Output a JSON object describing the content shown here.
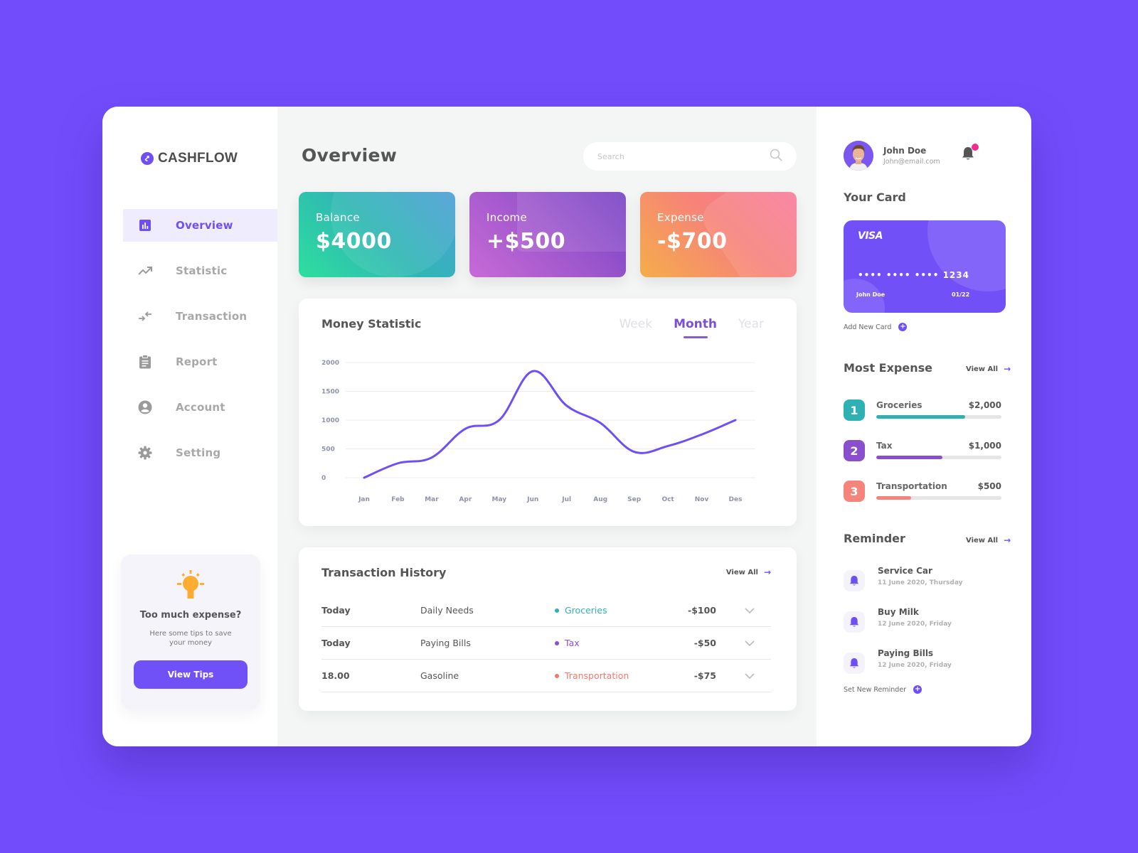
{
  "app": {
    "name": "CASHFLOW"
  },
  "sidebar": {
    "items": [
      {
        "label": "Overview",
        "icon": "bar-chart-icon",
        "active": true
      },
      {
        "label": "Statistic",
        "icon": "trending-up-icon",
        "active": false
      },
      {
        "label": "Transaction",
        "icon": "swap-arrows-icon",
        "active": false
      },
      {
        "label": "Report",
        "icon": "clipboard-icon",
        "active": false
      },
      {
        "label": "Account",
        "icon": "account-circle-icon",
        "active": false
      },
      {
        "label": "Setting",
        "icon": "gear-icon",
        "active": false
      }
    ],
    "tips": {
      "title": "Too much expense?",
      "subtitle": "Here some tips to save your money",
      "button": "View Tips"
    }
  },
  "main": {
    "title": "Overview",
    "search": {
      "placeholder": "Search",
      "value": ""
    },
    "cards": [
      {
        "label": "Balance",
        "value": "$4000"
      },
      {
        "label": "Income",
        "value": "+$500"
      },
      {
        "label": "Expense",
        "value": "-$700"
      }
    ],
    "money_statistic": {
      "title": "Money Statistic",
      "tabs": [
        {
          "label": "Week",
          "active": false
        },
        {
          "label": "Month",
          "active": true
        },
        {
          "label": "Year",
          "active": false
        }
      ]
    },
    "transactions": {
      "title": "Transaction History",
      "view_all": "View All",
      "rows": [
        {
          "date": "Today",
          "description": "Daily Needs",
          "category": "Groceries",
          "category_color": "#2fb1b3",
          "amount": "-$100"
        },
        {
          "date": "Today",
          "description": "Paying Bills",
          "category": "Tax",
          "category_color": "#8a4fcc",
          "amount": "-$50"
        },
        {
          "date": "18.00",
          "description": "Gasoline",
          "category": "Transportation",
          "category_color": "#f3786d",
          "amount": "-$75"
        }
      ]
    }
  },
  "chart_data": {
    "type": "line",
    "title": "Money Statistic",
    "categories": [
      "Jan",
      "Feb",
      "Mar",
      "Apr",
      "May",
      "Jun",
      "Jul",
      "Aug",
      "Sep",
      "Oct",
      "Nov",
      "Des"
    ],
    "series": [
      {
        "name": "Money",
        "values": [
          0,
          250,
          350,
          850,
          1000,
          1850,
          1250,
          950,
          450,
          550,
          750,
          1000
        ],
        "color": "#6f4ef5"
      }
    ],
    "yticks": [
      0,
      500,
      1000,
      1500,
      2000
    ],
    "ylim": [
      0,
      2000
    ],
    "xlabel": "",
    "ylabel": "",
    "grid": true,
    "legend": "none"
  },
  "right": {
    "user": {
      "name": "John Doe",
      "email": "John@email.com",
      "has_notification": true
    },
    "your_card": {
      "title": "Your Card",
      "brand": "VISA",
      "number": "•••• •••• •••• 1234",
      "holder": "John Doe",
      "expiry": "01/22",
      "add_label": "Add New Card"
    },
    "most_expense": {
      "title": "Most Expense",
      "view_all": "View All",
      "items": [
        {
          "rank": "1",
          "name": "Groceries",
          "amount": "$2,000",
          "progress": 0.71,
          "color": "#2fb1b3"
        },
        {
          "rank": "2",
          "name": "Tax",
          "amount": "$1,000",
          "progress": 0.53,
          "color": "#8a4fcc"
        },
        {
          "rank": "3",
          "name": "Transportation",
          "amount": "$500",
          "progress": 0.28,
          "color": "#f5847a"
        }
      ]
    },
    "reminder": {
      "title": "Reminder",
      "view_all": "View All",
      "items": [
        {
          "title": "Service Car",
          "date": "11 June 2020, Thursday"
        },
        {
          "title": "Buy Milk",
          "date": "12 June 2020, Friday"
        },
        {
          "title": "Paying Bills",
          "date": "12 June 2020, Friday"
        }
      ],
      "add_label": "Set New Reminder"
    }
  }
}
